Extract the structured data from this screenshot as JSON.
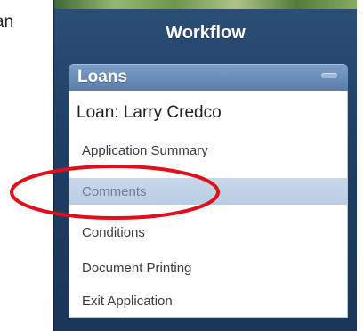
{
  "left_fragment": "an",
  "panel": {
    "title": "Workflow",
    "section": {
      "label": "Loans",
      "loan_name": "Loan: Larry Credco",
      "items": [
        {
          "label": "Application Summary"
        },
        {
          "label": "Comments"
        },
        {
          "label": "Conditions"
        },
        {
          "label": "Document Printing"
        },
        {
          "label": "Exit Application"
        }
      ],
      "selected_index": 1
    }
  },
  "annotation": {
    "shape": "ellipse",
    "color": "#e0101a",
    "target": "Comments"
  }
}
